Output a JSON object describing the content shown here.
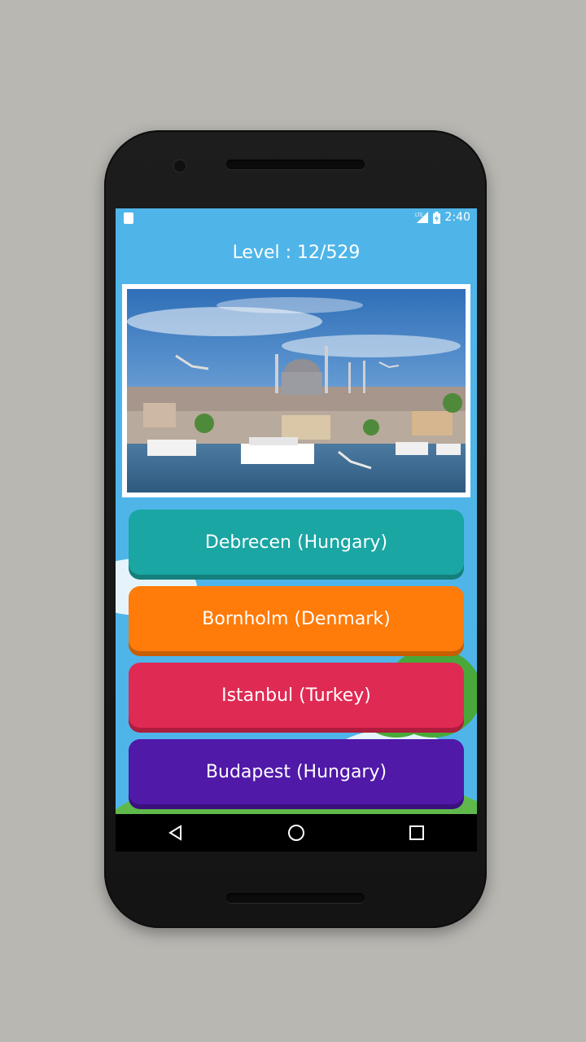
{
  "status_bar": {
    "network": "LTE",
    "time": "2:40"
  },
  "quiz": {
    "level_text": "Level : 12/529",
    "answers": [
      {
        "label": "Debrecen (Hungary)",
        "color": "#1aa6a3"
      },
      {
        "label": "Bornholm (Denmark)",
        "color": "#ff7b0a"
      },
      {
        "label": "Istanbul (Turkey)",
        "color": "#df2a53"
      },
      {
        "label": "Budapest (Hungary)",
        "color": "#5019a8"
      }
    ]
  },
  "nav_bar": {
    "icons": [
      "back-icon",
      "home-icon",
      "recents-icon"
    ]
  },
  "colors": {
    "screen_bg": "#4fb5e9",
    "device_body": "#1a1a1a",
    "page_bg": "#b9b7b2"
  }
}
